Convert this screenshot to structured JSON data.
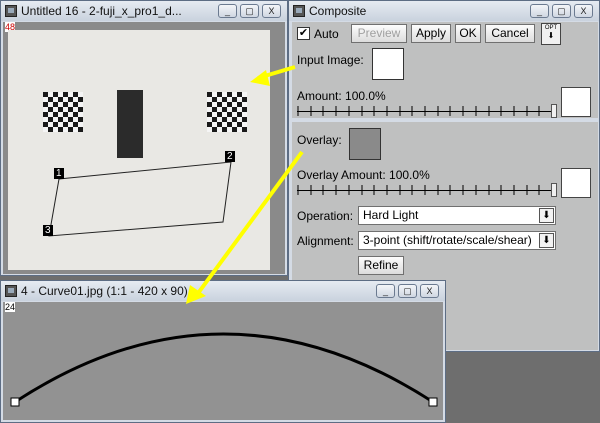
{
  "left_window": {
    "title": "Untitled 16 - 2-fuji_x_pro1_d...",
    "corner_label": "48",
    "points": [
      "1",
      "2",
      "3"
    ],
    "buttons": [
      "_",
      "▢",
      "X"
    ]
  },
  "composite_window": {
    "title": "Composite",
    "auto_label": "Auto",
    "auto_checked": true,
    "preview_label": "Preview",
    "apply_label": "Apply",
    "ok_label": "OK",
    "cancel_label": "Cancel",
    "opt_label": "OPT",
    "input_image_label": "Input Image:",
    "amount_label": "Amount: 100.0%",
    "overlay_label": "Overlay:",
    "overlay_amount_label": "Overlay Amount: 100.0%",
    "operation_label": "Operation:",
    "operation_value": "Hard Light",
    "alignment_label": "Alignment:",
    "alignment_value": "3-point (shift/rotate/scale/shear)",
    "refine_label": "Refine",
    "amount_level": 1.0,
    "overlay_amount_level": 1.0,
    "buttons": [
      "_",
      "▢",
      "X"
    ]
  },
  "curve_window": {
    "title": "4 - Curve01.jpg (1:1 - 420 x 90)",
    "corner_label": "24",
    "buttons": [
      "_",
      "▢",
      "X"
    ]
  },
  "colors": {
    "arrow": "#ffff00",
    "panel": "#bfc0c0",
    "canvas_gray": "#8a8a8a"
  }
}
